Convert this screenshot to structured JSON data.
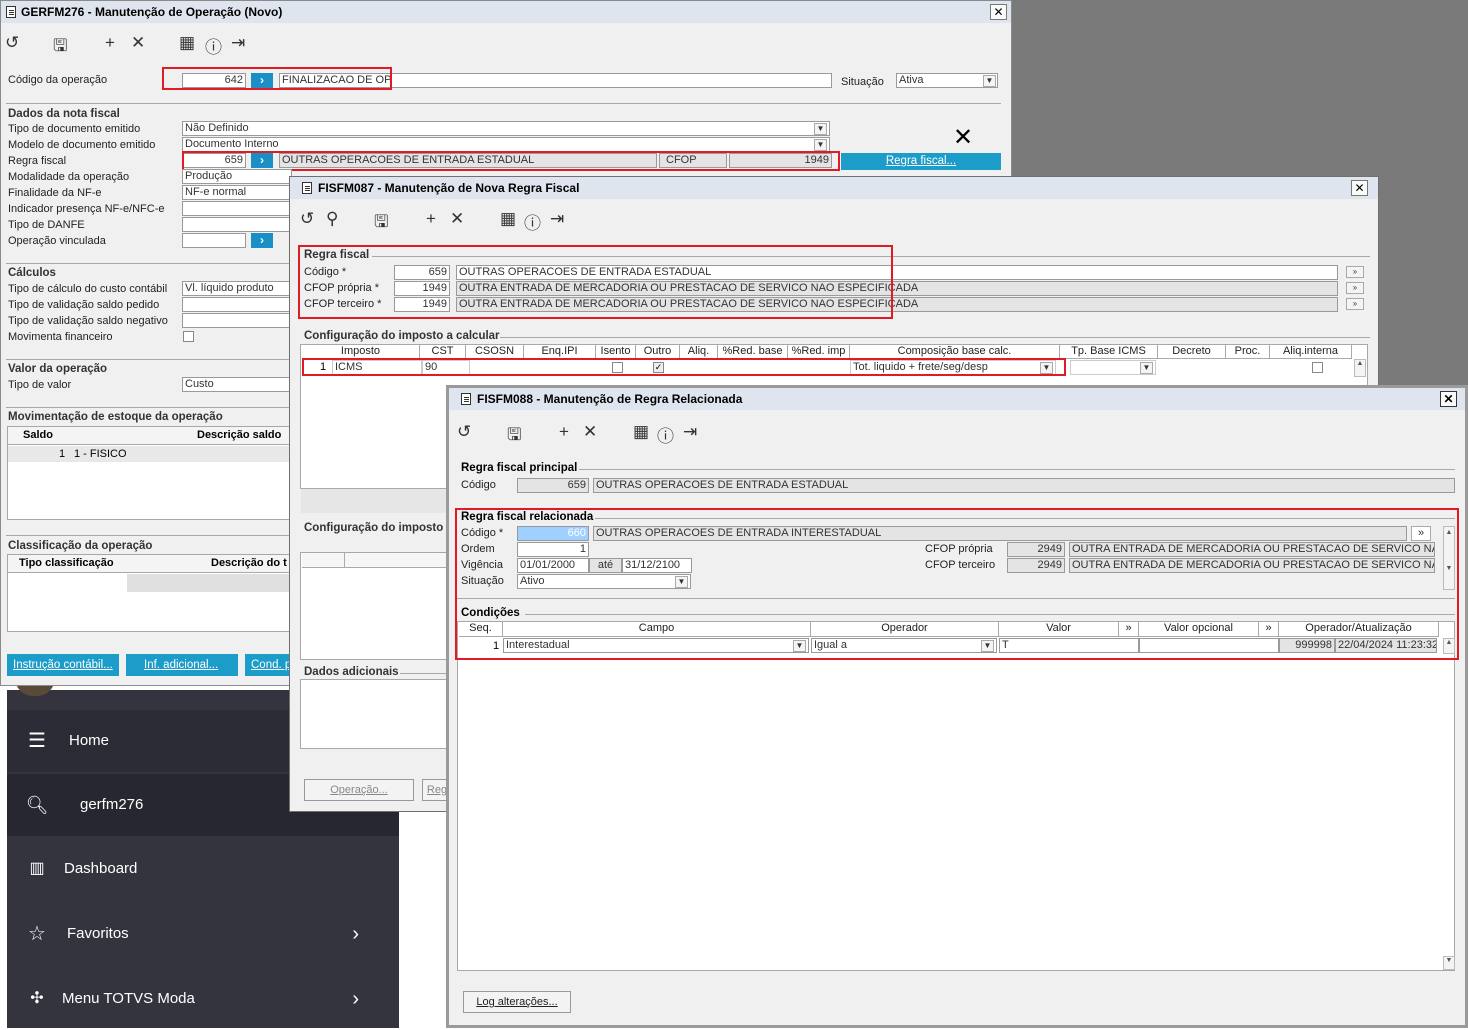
{
  "bg_color": "#7a7a7a",
  "nav": {
    "home": "Home",
    "search_value": "gerfm276",
    "dashboard": "Dashboard",
    "favoritos": "Favoritos",
    "menu_totvs": "Menu TOTVS Moda"
  },
  "win1": {
    "title": "GERFM276 - Manutenção de Operação (Novo)",
    "codigo_label": "Código da operação",
    "codigo_value": "642",
    "codigo_desc": "FINALIZACAO DE OP",
    "situacao_label": "Situação",
    "situacao_value": "Ativa",
    "dados_title": "Dados da nota fiscal",
    "tipo_doc_label": "Tipo de documento emitido",
    "tipo_doc_value": "Não Definido",
    "modelo_label": "Modelo de documento emitido",
    "modelo_value": "Documento Interno",
    "regra_label": "Regra fiscal",
    "regra_value": "659",
    "regra_desc": "OUTRAS OPERACOES DE ENTRADA ESTADUAL",
    "cfop_label": "CFOP",
    "cfop_value": "1949",
    "regra_btn": "Regra fiscal...",
    "modalidade_label": "Modalidade da operação",
    "modalidade_value": "Produção",
    "finalidade_label": "Finalidade da NF-e",
    "finalidade_value": "NF-e normal",
    "indicador_label": "Indicador presença NF-e/NFC-e",
    "danfe_label": "Tipo de DANFE",
    "vinculada_label": "Operação vinculada",
    "calculos_title": "Cálculos",
    "custo_label": "Tipo de cálculo do custo contábil",
    "custo_value": "Vl. líquido produto",
    "saldo_pedido_label": "Tipo de validação saldo pedido",
    "saldo_neg_label": "Tipo de validação saldo negativo",
    "movfin_label": "Movimenta financeiro",
    "valor_title": "Valor da operação",
    "tipo_valor_label": "Tipo de valor",
    "tipo_valor_value": "Custo",
    "estoque_title": "Movimentação de estoque da operação",
    "col_saldo": "Saldo",
    "col_desc_saldo": "Descrição saldo",
    "row_saldo": "1",
    "row_desc": "1 - FISICO",
    "classif_title": "Classificação da operação",
    "col_tipo_classif": "Tipo classificação",
    "col_desc_classif": "Descrição do t",
    "btn_instrucao": "Instrução contábil...",
    "btn_inf": "Inf. adicional...",
    "btn_cond": "Cond. p"
  },
  "win2": {
    "title": "FISFM087 - Manutenção de Nova Regra Fiscal",
    "regra_title": "Regra fiscal",
    "codigo_label": "Código *",
    "codigo_value": "659",
    "codigo_desc": "OUTRAS OPERACOES DE ENTRADA ESTADUAL",
    "cfop_propria_label": "CFOP própria *",
    "cfop_propria_value": "1949",
    "cfop_propria_desc": "OUTRA ENTRADA DE MERCADORIA OU PRESTACAO DE SERVICO NAO ESPECIFICADA",
    "cfop_terc_label": "CFOP terceiro *",
    "cfop_terc_value": "1949",
    "cfop_terc_desc": "OUTRA ENTRADA DE MERCADORIA OU PRESTACAO DE SERVICO NAO ESPECIFICADA",
    "config_title": "Configuração do imposto a calcular",
    "cols": [
      "Imposto",
      "CST",
      "CSOSN",
      "Enq.IPI",
      "Isento",
      "Outro",
      "Aliq.",
      "%Red. base",
      "%Red. imp",
      "Composição base calc.",
      "Tp. Base ICMS",
      "Decreto",
      "Proc.",
      "Aliq.interna"
    ],
    "row_num": "1",
    "row_imposto": "ICMS",
    "row_cst": "90",
    "row_comp": "Tot. liquido + frete/seg/desp",
    "config2_title": "Configuração do imposto",
    "dados_adic_title": "Dados adicionais",
    "btn_operacao": "Operação...",
    "btn_reg": "Reg"
  },
  "win3": {
    "title": "FISFM088 - Manutenção de Regra Relacionada",
    "principal_title": "Regra fiscal principal",
    "codigo_label": "Código",
    "codigo_value": "659",
    "codigo_desc": "OUTRAS OPERACOES DE ENTRADA ESTADUAL",
    "relacionada_title": "Regra fiscal relacionada",
    "rel_codigo_label": "Código *",
    "rel_codigo_value": "660",
    "rel_codigo_desc": "OUTRAS OPERACOES DE ENTRADA INTERESTADUAL",
    "ordem_label": "Ordem",
    "ordem_value": "1",
    "vigencia_label": "Vigência",
    "vig_ini": "01/01/2000",
    "ate_label": "até",
    "vig_fim": "31/12/2100",
    "situacao_label": "Situação",
    "situacao_value": "Ativo",
    "cfop_propria_label": "CFOP própria",
    "cfop_propria_value": "2949",
    "cfop_propria_desc": "OUTRA ENTRADA DE MERCADORIA OU PRESTACAO DE SERVICO NAO ES",
    "cfop_terc_label": "CFOP terceiro",
    "cfop_terc_value": "2949",
    "cfop_terc_desc": "OUTRA ENTRADA DE MERCADORIA OU PRESTACAO DE SERVICO NAO ES",
    "condicoes_title": "Condições",
    "col_seq": "Seq.",
    "col_campo": "Campo",
    "col_operador": "Operador",
    "col_valor": "Valor",
    "col_valor_opc": "Valor opcional",
    "col_oper_atual": "Operador/Atualização",
    "row_seq": "1",
    "row_campo": "Interestadual",
    "row_operador": "Igual a",
    "row_valor": "T",
    "row_oper": "999998",
    "row_data": "22/04/2024 11:23:32",
    "btn_log": "Log alterações..."
  }
}
